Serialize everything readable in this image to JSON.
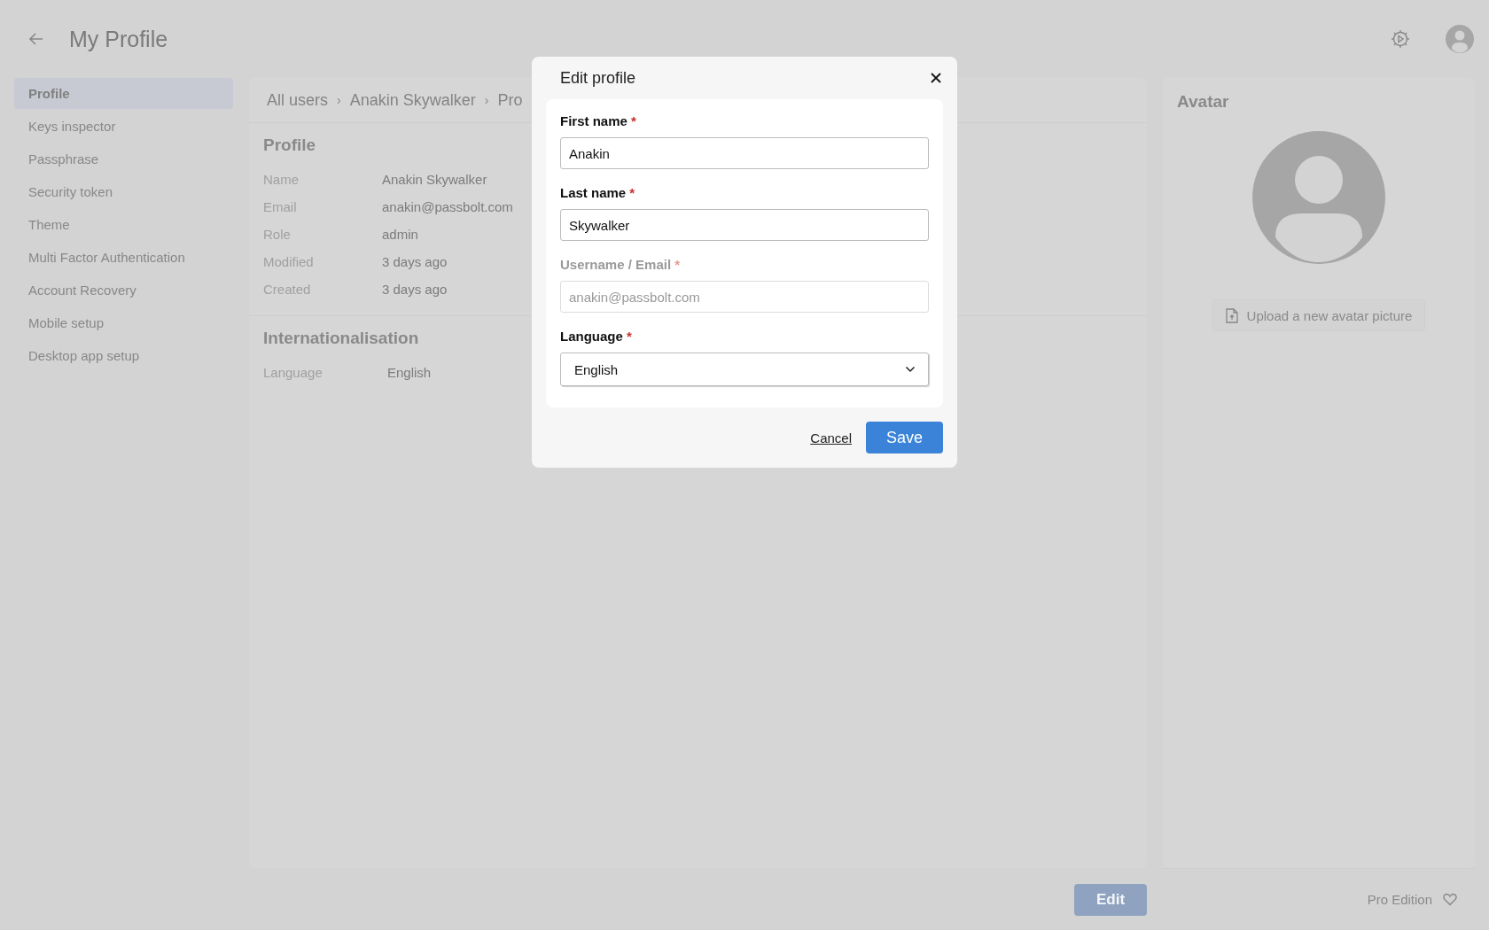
{
  "header": {
    "title": "My Profile"
  },
  "sidebar": {
    "items": [
      {
        "label": "Profile",
        "selected": true
      },
      {
        "label": "Keys inspector",
        "selected": false
      },
      {
        "label": "Passphrase",
        "selected": false
      },
      {
        "label": "Security token",
        "selected": false
      },
      {
        "label": "Theme",
        "selected": false
      },
      {
        "label": "Multi Factor Authentication",
        "selected": false
      },
      {
        "label": "Account Recovery",
        "selected": false
      },
      {
        "label": "Mobile setup",
        "selected": false
      },
      {
        "label": "Desktop app setup",
        "selected": false
      }
    ]
  },
  "breadcrumb": [
    {
      "label": "All users"
    },
    {
      "separator": "›",
      "label": "Anakin Skywalker"
    },
    {
      "separator": "›",
      "label": "Pro"
    }
  ],
  "profile": {
    "title": "Profile",
    "rows": [
      {
        "label": "Name",
        "value": "Anakin Skywalker"
      },
      {
        "label": "Email",
        "value": "anakin@passbolt.com"
      },
      {
        "label": "Role",
        "value": "admin"
      },
      {
        "label": "Modified",
        "value": "3 days ago"
      },
      {
        "label": "Created",
        "value": "3 days ago"
      }
    ]
  },
  "internationalisation": {
    "title": "Internationalisation",
    "rows": [
      {
        "label": "Language",
        "value": "English"
      }
    ]
  },
  "avatar": {
    "title": "Avatar",
    "upload_button": "Upload a new avatar picture"
  },
  "edit_button": {
    "label": "Edit",
    "disabled": true
  },
  "footer": {
    "edition": "Pro Edition"
  },
  "dialog": {
    "title": "Edit profile",
    "fields": [
      {
        "kind": "text",
        "label": "First name",
        "required_mark": "*",
        "disabled": false,
        "value": "Anakin"
      },
      {
        "kind": "text",
        "label": "Last name",
        "required_mark": "*",
        "disabled": false,
        "value": "Skywalker"
      },
      {
        "kind": "text",
        "label": "Username / Email",
        "required_mark": "*",
        "disabled": true,
        "value": "anakin@passbolt.com"
      },
      {
        "kind": "select",
        "label": "Language",
        "required_mark": "*",
        "disabled": false,
        "value": "English"
      }
    ],
    "cancel": "Cancel",
    "save": "Save"
  }
}
